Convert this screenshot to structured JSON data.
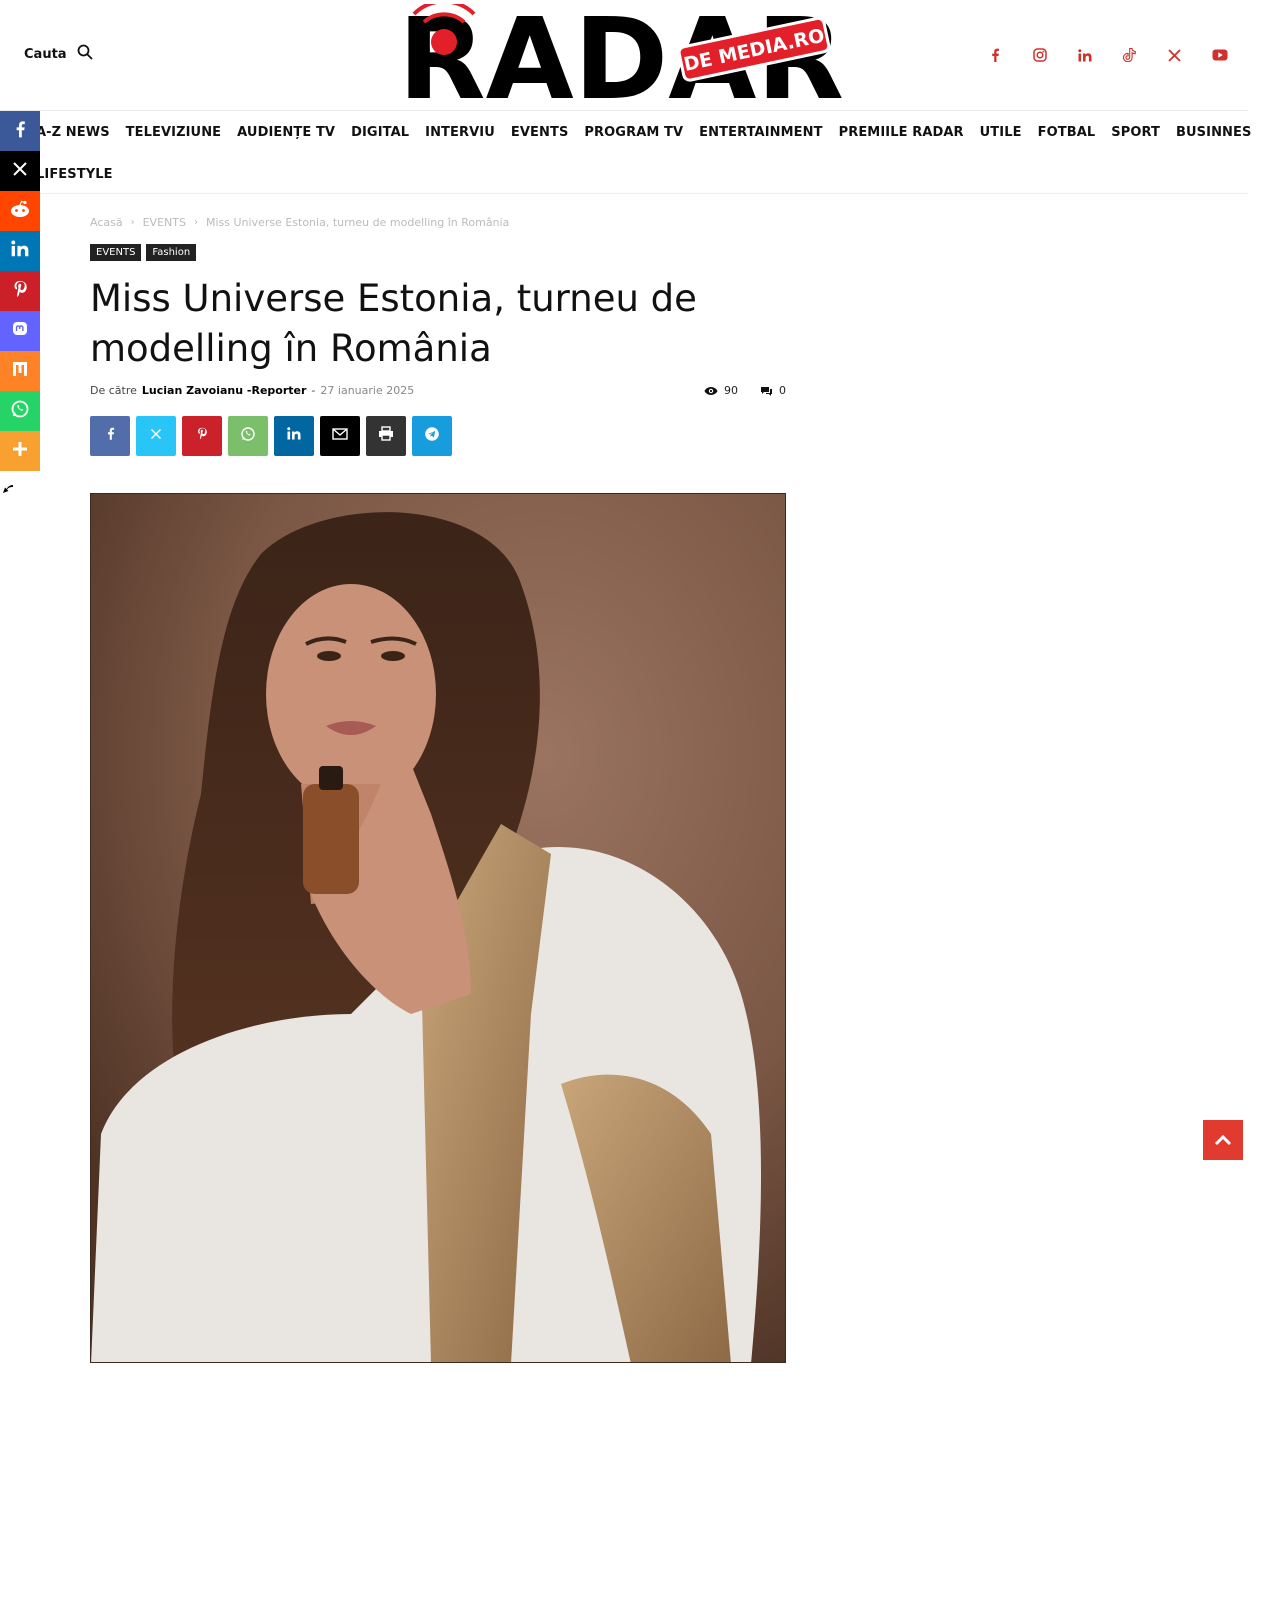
{
  "header": {
    "search_label": "Cauta",
    "logo": {
      "main_text": "RADAR",
      "sub_text": "DE MEDIA.RO",
      "red": "#e3202a"
    },
    "socials": [
      "facebook-icon",
      "instagram-icon",
      "linkedin-icon",
      "tiktok-icon",
      "x-icon",
      "youtube-icon"
    ],
    "social_color": "#d0312d"
  },
  "nav": {
    "row1": [
      "A-Z NEWS",
      "TELEVIZIUNE",
      "AUDIENȚE TV",
      "DIGITAL",
      "INTERVIU",
      "EVENTS",
      "PROGRAM TV",
      "ENTERTAINMENT",
      "PREMIILE RADAR",
      "UTILE",
      "FOTBAL",
      "SPORT",
      "BUSINNES"
    ],
    "row2": [
      "LIFESTYLE"
    ]
  },
  "rail": [
    {
      "name": "facebook",
      "color": "#3b5998"
    },
    {
      "name": "x",
      "color": "#000000"
    },
    {
      "name": "reddit",
      "color": "#ff4500"
    },
    {
      "name": "linkedin",
      "color": "#0077b5"
    },
    {
      "name": "pinterest",
      "color": "#cb2027"
    },
    {
      "name": "mastodon",
      "color": "#6364ff"
    },
    {
      "name": "mix",
      "color": "#ff8226"
    },
    {
      "name": "whatsapp",
      "color": "#25d366"
    },
    {
      "name": "more",
      "color": "#f8a131"
    }
  ],
  "breadcrumb": {
    "home": "Acasă",
    "category": "EVENTS",
    "current": "Miss Universe Estonia, turneu de modelling în România"
  },
  "tags": [
    "EVENTS",
    "Fashion"
  ],
  "article": {
    "title": "Miss Universe Estonia, turneu de modelling în România",
    "by_label": "De către",
    "author": "Lucian Zavoianu -Reporter",
    "dash": "-",
    "date": "27 ianuarie 2025",
    "views": "90",
    "comments": "0"
  },
  "share": [
    {
      "name": "facebook",
      "color": "#516eab"
    },
    {
      "name": "x",
      "color": "#29c5f6"
    },
    {
      "name": "pinterest",
      "color": "#ca212a"
    },
    {
      "name": "whatsapp",
      "color": "#7bbf6a"
    },
    {
      "name": "linkedin",
      "color": "#0266a0"
    },
    {
      "name": "email",
      "color": "#000000"
    },
    {
      "name": "print",
      "color": "#333333"
    },
    {
      "name": "telegram",
      "color": "#179cde"
    }
  ],
  "back_to_top_color": "#e13a2f"
}
